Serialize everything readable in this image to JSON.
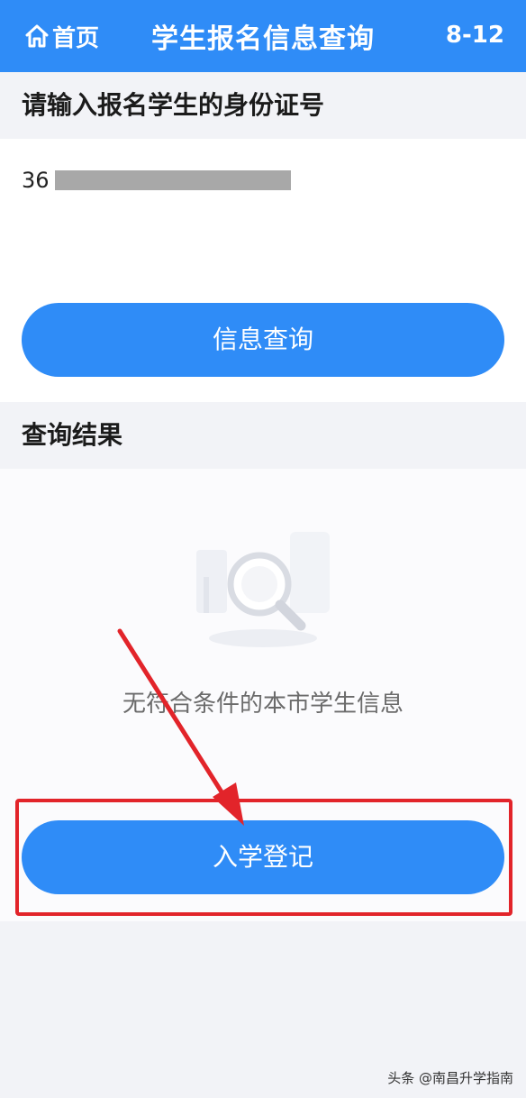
{
  "header": {
    "home_label": "首页",
    "title": "学生报名信息查询",
    "right_text": "8-12"
  },
  "input_section": {
    "label": "请输入报名学生的身份证号",
    "id_visible_prefix": "36"
  },
  "query_button_label": "信息查询",
  "result_section": {
    "label": "查询结果",
    "empty_message": "无符合条件的本市学生信息"
  },
  "register_button_label": "入学登记",
  "watermark": "头条 @南昌升学指南",
  "colors": {
    "primary": "#2f8cf7",
    "highlight": "#e2242a",
    "background": "#f2f3f7"
  }
}
